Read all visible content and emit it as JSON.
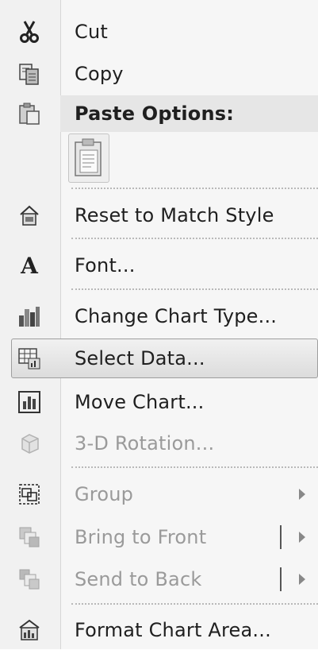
{
  "menu": {
    "items": {
      "cut": {
        "label": "Cut",
        "icon": "scissors-icon"
      },
      "copy": {
        "label": "Copy",
        "icon": "copy-icon"
      },
      "paste_options": {
        "label": "Paste Options:",
        "icon": "clipboard-icon"
      },
      "paste_keep": {
        "icon": "paste-keep-text-icon"
      },
      "reset": {
        "label": "Reset to Match Style",
        "icon": "reset-style-icon"
      },
      "font": {
        "label": "Font...",
        "icon": "font-icon"
      },
      "change_chart_type": {
        "label": "Change Chart Type...",
        "icon": "chart-type-icon"
      },
      "select_data": {
        "label": "Select Data...",
        "icon": "select-data-icon"
      },
      "move_chart": {
        "label": "Move Chart...",
        "icon": "move-chart-icon"
      },
      "rotation": {
        "label": "3-D Rotation...",
        "icon": "cube-icon"
      },
      "group": {
        "label": "Group",
        "icon": "group-icon"
      },
      "bring_front": {
        "label": "Bring to Front",
        "icon": "bring-front-icon"
      },
      "send_back": {
        "label": "Send to Back",
        "icon": "send-back-icon"
      },
      "format_area": {
        "label": "Format Chart Area...",
        "icon": "format-area-icon"
      }
    }
  }
}
